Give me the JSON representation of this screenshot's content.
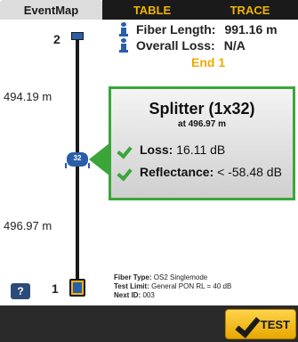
{
  "tabs": [
    {
      "label": "EventMap",
      "active": true
    },
    {
      "label": "TABLE",
      "active": false
    },
    {
      "label": "TRACE",
      "active": false
    }
  ],
  "summary": {
    "fiber_length_label": "Fiber Length:",
    "fiber_length_value": "991.16 m",
    "overall_loss_label": "Overall Loss:",
    "overall_loss_value": "N/A",
    "end_label": "End 1"
  },
  "event_map": {
    "node_top_number": "2",
    "node_bottom_number": "1",
    "distance_upper": "494.19 m",
    "distance_lower": "496.97 m",
    "splitter_icon_label": "32"
  },
  "callout": {
    "title": "Splitter (1x32)",
    "subtitle": "at 496.97 m",
    "loss_label": "Loss:",
    "loss_value": "16.11 dB",
    "reflectance_label": "Reflectance:",
    "reflectance_value": "< -58.48 dB"
  },
  "fiber_info": {
    "type_label": "Fiber Type:",
    "type_value": "OS2 Singlemode",
    "limit_label": "Test Limit:",
    "limit_value": "General PON RL = 40 dB",
    "next_id_label": "Next ID:",
    "next_id_value": "003"
  },
  "help_label": "?",
  "test_label": "TEST",
  "colors": {
    "accent_green": "#3aa63a",
    "accent_yellow": "#f0b400",
    "icon_blue": "#2b5ea8"
  }
}
